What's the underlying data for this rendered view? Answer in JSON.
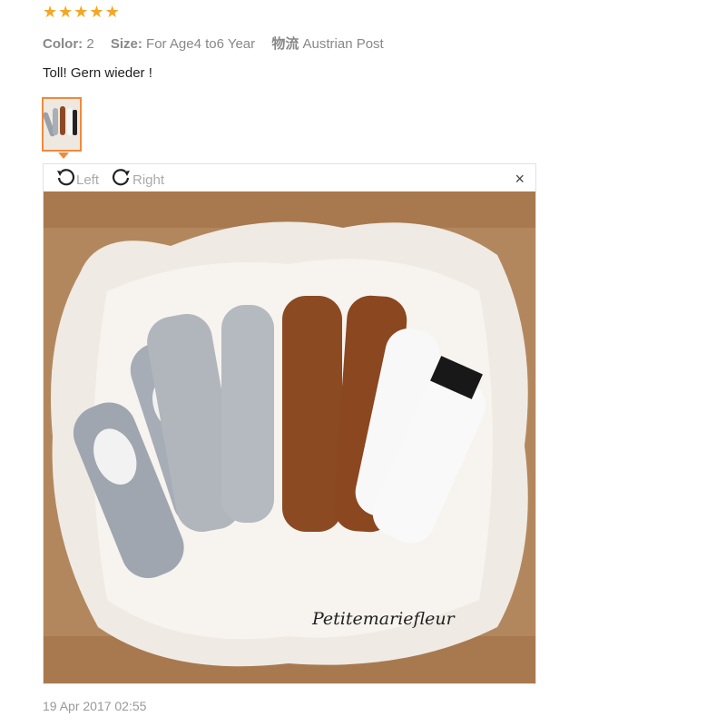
{
  "review": {
    "rating": 5,
    "rating_max": 5,
    "color_label": "Color:",
    "color_value": "2",
    "size_label": "Size:",
    "size_value": "For Age4 to6 Year",
    "shipping_label": "物流",
    "shipping_value": "Austrian Post",
    "comment": "Toll! Gern wieder !",
    "date": "19 Apr 2017 02:55"
  },
  "viewer": {
    "rotate_left_label": "Left",
    "rotate_right_label": "Right",
    "close_label": "×",
    "photo_watermark": "Petitemariefleur"
  },
  "colors": {
    "star": "#f5a623",
    "thumb_border": "#f08a3c"
  }
}
